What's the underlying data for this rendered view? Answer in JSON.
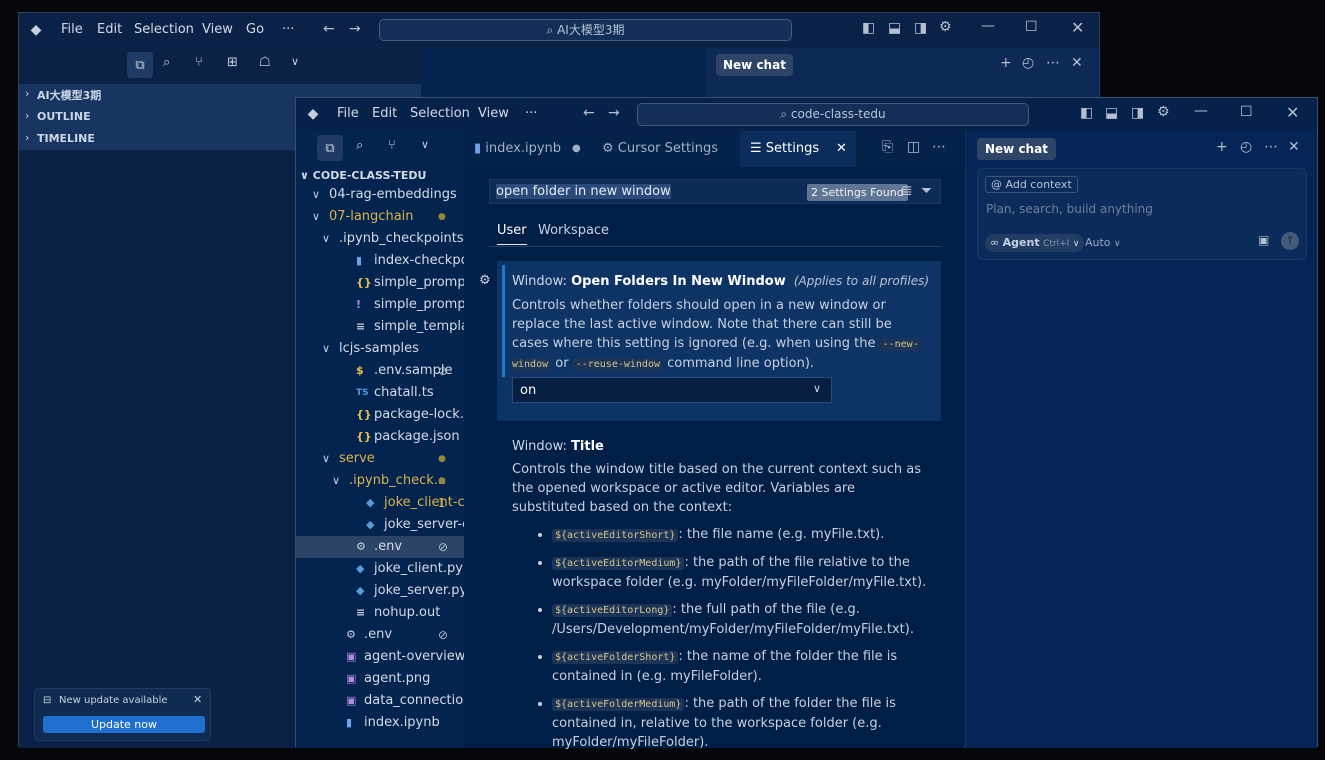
{
  "back_window": {
    "menu": [
      "File",
      "Edit",
      "Selection",
      "View",
      "Go"
    ],
    "more": "···",
    "search": "AI大模型3期",
    "sections": [
      "AI大模型3期",
      "OUTLINE",
      "TIMELINE"
    ],
    "chat_button": "New chat",
    "update": {
      "title": "New update available",
      "button": "Update now"
    }
  },
  "front_window": {
    "menu": [
      "File",
      "Edit",
      "Selection",
      "View"
    ],
    "more": "···",
    "search": "code-class-tedu",
    "explorer_title": "CODE-CLASS-TEDU",
    "tree": [
      {
        "label": "04-rag-embeddings",
        "indent": 0,
        "chev": "v",
        "icon": "",
        "color": "#d4dbe6",
        "badge": ""
      },
      {
        "label": "07-langchain",
        "indent": 0,
        "chev": "v",
        "icon": "",
        "color": "#d9b54a",
        "badge": "●"
      },
      {
        "label": ".ipynb_checkpoints",
        "indent": 1,
        "chev": "v",
        "icon": "",
        "color": "#d4dbe6",
        "badge": ""
      },
      {
        "label": "index-checkpoint.i...",
        "indent": 2,
        "chev": "",
        "icon": "▮",
        "color": "#d4dbe6",
        "badge": ""
      },
      {
        "label": "simple_prompt-ch...",
        "indent": 2,
        "chev": "",
        "icon": "{}",
        "color": "#d4dbe6",
        "badge": ""
      },
      {
        "label": "simple_prompt-ch...",
        "indent": 2,
        "chev": "",
        "icon": "!",
        "color": "#d4dbe6",
        "badge": ""
      },
      {
        "label": "simple_template-c...",
        "indent": 2,
        "chev": "",
        "icon": "≡",
        "color": "#d4dbe6",
        "badge": ""
      },
      {
        "label": "lcjs-samples",
        "indent": 1,
        "chev": "v",
        "icon": "",
        "color": "#d4dbe6",
        "badge": ""
      },
      {
        "label": ".env.sample",
        "indent": 2,
        "chev": "",
        "icon": "$",
        "color": "#d4dbe6",
        "badge": "⊘"
      },
      {
        "label": "chatall.ts",
        "indent": 2,
        "chev": "",
        "icon": "TS",
        "color": "#d4dbe6",
        "badge": ""
      },
      {
        "label": "package-lock.json",
        "indent": 2,
        "chev": "",
        "icon": "{}",
        "color": "#d4dbe6",
        "badge": ""
      },
      {
        "label": "package.json",
        "indent": 2,
        "chev": "",
        "icon": "{}",
        "color": "#d4dbe6",
        "badge": ""
      },
      {
        "label": "serve",
        "indent": 1,
        "chev": "v",
        "icon": "",
        "color": "#d9b54a",
        "badge": "●"
      },
      {
        "label": ".ipynb_check...",
        "indent": 2,
        "chev": "v",
        "icon": "",
        "color": "#d9b54a",
        "badge": "●"
      },
      {
        "label": "joke_client-c...",
        "indent": 3,
        "chev": "",
        "icon": "py",
        "color": "#d9b54a",
        "badge": "1"
      },
      {
        "label": "joke_server-check...",
        "indent": 3,
        "chev": "",
        "icon": "py",
        "color": "#d4dbe6",
        "badge": ""
      },
      {
        "label": ".env",
        "indent": 2,
        "chev": "",
        "icon": "⚙",
        "color": "#d4dbe6",
        "badge": "⊘"
      },
      {
        "label": "joke_client.py",
        "indent": 2,
        "chev": "",
        "icon": "py",
        "color": "#d4dbe6",
        "badge": ""
      },
      {
        "label": "joke_server.py",
        "indent": 2,
        "chev": "",
        "icon": "py",
        "color": "#d4dbe6",
        "badge": ""
      },
      {
        "label": "nohup.out",
        "indent": 2,
        "chev": "",
        "icon": "≡",
        "color": "#d4dbe6",
        "badge": ""
      },
      {
        "label": ".env",
        "indent": 1,
        "chev": "",
        "icon": "⚙",
        "color": "#d4dbe6",
        "badge": "⊘"
      },
      {
        "label": "agent-overview.png",
        "indent": 1,
        "chev": "",
        "icon": "img",
        "color": "#d4dbe6",
        "badge": ""
      },
      {
        "label": "agent.png",
        "indent": 1,
        "chev": "",
        "icon": "img",
        "color": "#d4dbe6",
        "badge": ""
      },
      {
        "label": "data_connection.jpg",
        "indent": 1,
        "chev": "",
        "icon": "img",
        "color": "#d4dbe6",
        "badge": ""
      },
      {
        "label": "index.ipynb",
        "indent": 1,
        "chev": "",
        "icon": "▮",
        "color": "#d4dbe6",
        "badge": ""
      }
    ],
    "tabs": {
      "t1": "index.ipynb",
      "t2": "Cursor Settings",
      "t3": "Settings"
    },
    "settings": {
      "query": "open folder in new window",
      "found": "2 Settings Found",
      "scope_user": "User",
      "scope_workspace": "Workspace",
      "s1": {
        "prefix": "Window: ",
        "name": "Open Folders In New Window",
        "applies": "(Applies to all profiles)",
        "d1": "Controls whether folders should open in a new window or replace the last active window. Note that there can still be cases where this setting is ignored (e.g. when using the ",
        "c1": "--new-window",
        "or": " or ",
        "c2": "--reuse-window",
        "d2": " command line option).",
        "value": "on"
      },
      "s2": {
        "prefix": "Window: ",
        "name": "Title",
        "desc": "Controls the window title based on the current context such as the opened workspace or active editor. Variables are substituted based on the context:",
        "items": [
          {
            "code": "${activeEditorShort}",
            "text": ": the file name (e.g. myFile.txt)."
          },
          {
            "code": "${activeEditorMedium}",
            "text": ": the path of the file relative to the workspace folder (e.g. myFolder/myFileFolder/myFile.txt)."
          },
          {
            "code": "${activeEditorLong}",
            "text": ": the full path of the file (e.g. /Users/Development/myFolder/myFileFolder/myFile.txt)."
          },
          {
            "code": "${activeFolderShort}",
            "text": ": the name of the folder the file is contained in (e.g. myFileFolder)."
          },
          {
            "code": "${activeFolderMedium}",
            "text": ": the path of the folder the file is contained in, relative to the workspace folder (e.g. myFolder/myFileFolder)."
          }
        ]
      }
    },
    "chat": {
      "new_chat": "New chat",
      "add_context": "Add context",
      "placeholder": "Plan, search, build anything",
      "agent": "Agent",
      "shortcut": "Ctrl+I",
      "model": "Auto"
    }
  }
}
